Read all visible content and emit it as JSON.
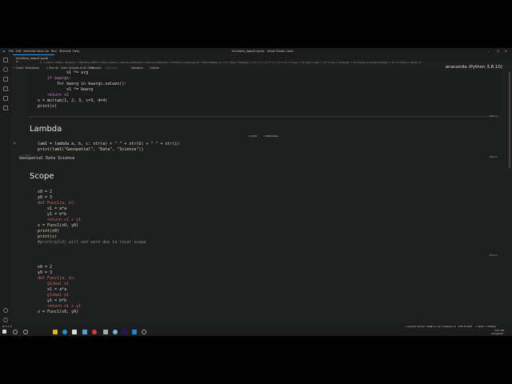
{
  "window": {
    "menu": [
      "File",
      "Edit",
      "Selection",
      "View",
      "Go",
      "Run",
      "Terminal",
      "Help"
    ],
    "title": "functions_loops2.ipynb - Visual Studio Code"
  },
  "tab": {
    "label": "functions_loops2.ipynb"
  },
  "breadcrumb": "C: > Users > Data > Dropbox > Teaching_WWU > data_science > lecture_notebooks > lecture_notebooks > functions_loops2.ipynb > def multab(a, b, c=1, *args, **kwargs): > x1 = 1 > x1 *= a > x1 *= b > if args: > for arg in args: > x1 *= arg > if kwargs: > for kwarg in kwargs.values(): > x1 *= kwarg > return x1",
  "toolbar": {
    "code": "+ Code",
    "markdown": "+ Markdown",
    "run_all": "▷ Run All",
    "clear": "Clear Outputs of All Cells",
    "restart": "↻ Restart",
    "interrupt": "Interrupt",
    "variables": "Variables",
    "outline": "Outline",
    "kernel": "anaconda (Python 3.8.10)"
  },
  "cell_toolbar": {
    "code": "+ Code",
    "markdown": "+ Markdown"
  },
  "lang": "Python",
  "cells": {
    "c1": [
      "    x1 *= arg",
      "if kwargs:",
      "    for kwarg in kwargs.values():",
      "        x1 *= kwarg",
      "return x1",
      "",
      "x = multab(1, 2, 3, c=3, d=4)",
      "print(x)"
    ],
    "h_lambda": "Lambda",
    "c2": [
      "lam1 = lambda a, b, c: str(a) + \" \" + str(b) + \" \" + str(c)",
      "print(lam1(\"Geospatial\", \"Data\", \"Science\"))"
    ],
    "c2_time": "✓ 0.0s",
    "c2_out": "Geospatial Data Science",
    "h_scope": "Scope",
    "c3": [
      "x0 = 2",
      "y0 = 3",
      "def Func1(a, b):",
      "    x1 = a*a",
      "    y1 = b*b",
      "    return x1 + y1",
      "",
      "z = Func1(x0, y0)",
      "print(x0)",
      "print(z)",
      "#print(x1+2) will not work due to local scope"
    ],
    "c4": [
      "x0 = 2",
      "y0 = 3",
      "def Func1(a, b):",
      "    global x1",
      "    x1 = a*a",
      "    global y1",
      "    y1 = b*b",
      "    return x1 + y1",
      "",
      "z = Func1(x0, y0)"
    ]
  },
  "status": {
    "left": "⊗ 0 ⚠ 0",
    "items": [
      "✓ Jupyter Server: local",
      "Ln 1, Col 1 Spaces: 4",
      "UTF-8 CRLF",
      "✓ Spell",
      "✓ Prettier"
    ],
    "time": "4:07 PM",
    "date": "2/10/2023"
  }
}
